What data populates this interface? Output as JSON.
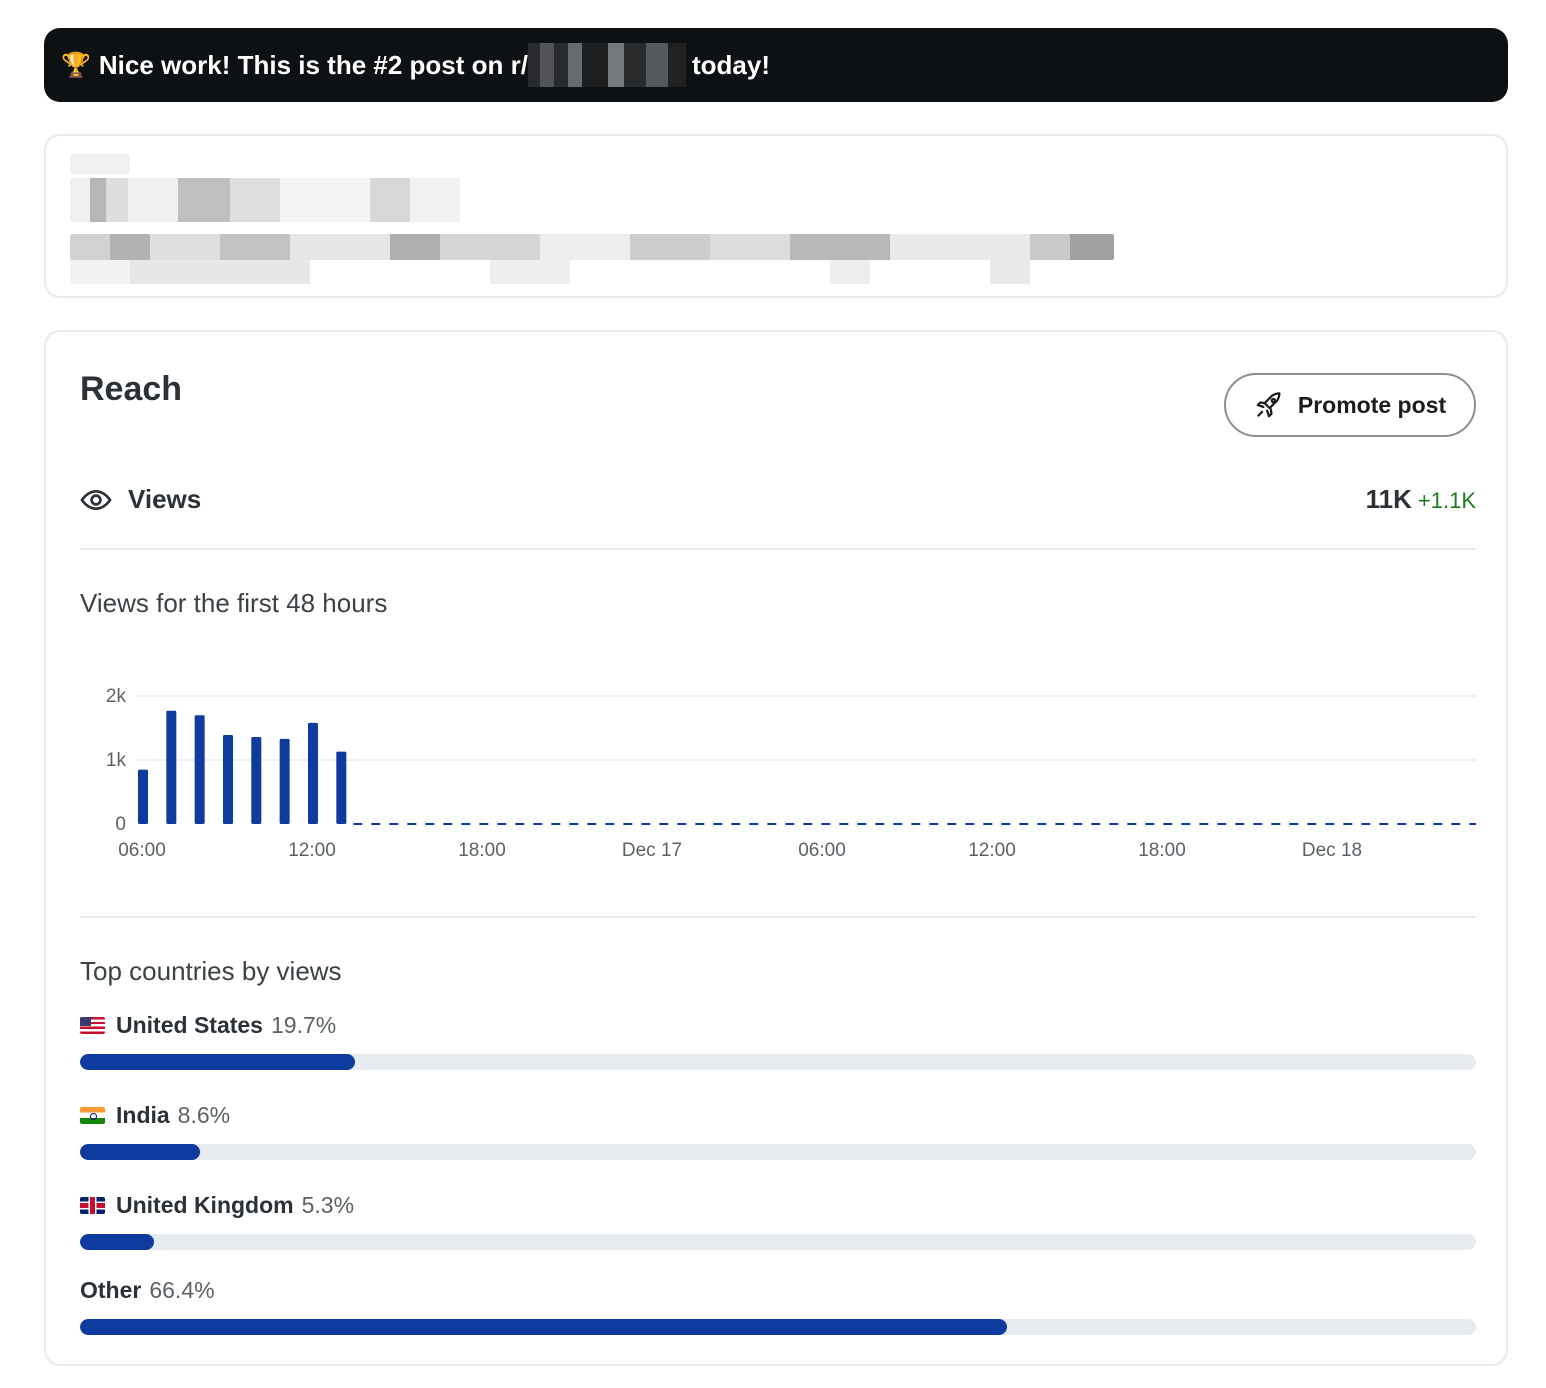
{
  "banner": {
    "icon": "trophy-icon",
    "text_before": "Nice work! This is the #2 post on r/",
    "text_after": "today!"
  },
  "reach": {
    "title": "Reach",
    "promote_label": "Promote post",
    "views_label": "Views",
    "views_value": "11K",
    "views_delta": "+1.1K",
    "delta_color": "#1f7a1f",
    "accent_color": "#0d3b9e"
  },
  "chart_data": {
    "type": "bar",
    "title": "Views for the first 48 hours",
    "x_tick_labels": [
      "06:00",
      "12:00",
      "18:00",
      "Dec 17",
      "06:00",
      "12:00",
      "18:00",
      "Dec 18"
    ],
    "y_tick_labels": [
      "0",
      "1k",
      "2k"
    ],
    "ylim": [
      0,
      2000
    ],
    "hours_from_start": [
      0,
      1,
      2,
      3,
      4,
      5,
      6,
      7
    ],
    "values": [
      850,
      1770,
      1700,
      1390,
      1360,
      1330,
      1580,
      1130
    ],
    "projection_style": "dashed zero line after last bar",
    "grid": true,
    "color": "#0d3b9e"
  },
  "countries": {
    "title": "Top countries by views",
    "items": [
      {
        "name": "United States",
        "pct": "19.7%",
        "value": 19.7,
        "flag": "us-flag-icon"
      },
      {
        "name": "India",
        "pct": "8.6%",
        "value": 8.6,
        "flag": "india-flag-icon"
      },
      {
        "name": "United Kingdom",
        "pct": "5.3%",
        "value": 5.3,
        "flag": "uk-flag-icon"
      },
      {
        "name": "Other",
        "pct": "66.4%",
        "value": 66.4,
        "flag": ""
      }
    ]
  }
}
